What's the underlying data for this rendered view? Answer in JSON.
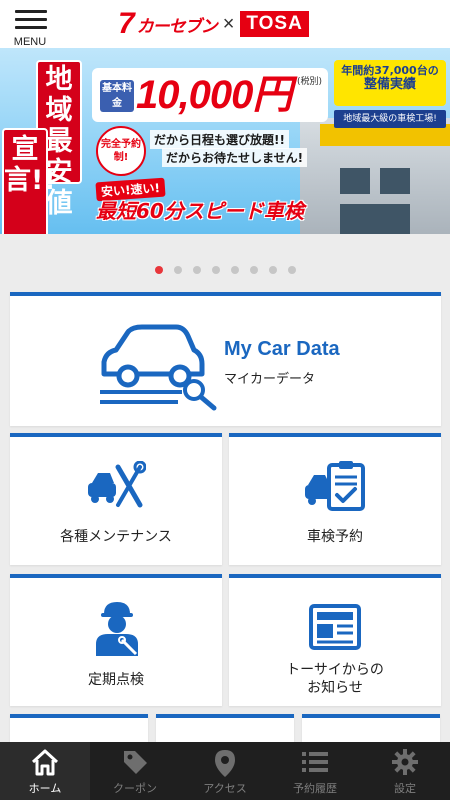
{
  "header": {
    "menu_label": "MENU",
    "logo_seven": "7",
    "logo_brand": "カーセブン",
    "logo_cross": "×",
    "logo_partner": "TOSA"
  },
  "banner": {
    "slogan_line1": "地域最",
    "slogan_line2": "宣言!!",
    "slogan_line3": "安値",
    "price_tag": "基本料金",
    "price_value": "10,000円",
    "price_tax": "(税別)",
    "record_line1": "年間約37,000台の",
    "record_line2": "整備実績",
    "record_sub": "地域最大級の車検工場!",
    "plan_circle": "完全予約制!",
    "plan_line1": "だから日程も選び放題!!",
    "plan_line2": "だからお待たせしません!",
    "speed_tag": "安い!速い!",
    "speed_line": "最短60分スピード車検"
  },
  "carousel": {
    "dot_count": 8,
    "active_index": 0
  },
  "cards": {
    "mycar_title": "My Car Data",
    "mycar_sub": "マイカーデータ",
    "maintenance": "各種メンテナンス",
    "inspection_reserve": "車検予約",
    "periodic_check": "定期点検",
    "news_line1": "トーサイからの",
    "news_line2": "お知らせ"
  },
  "tabs": [
    {
      "label": "ホーム",
      "icon": "home-icon",
      "active": true
    },
    {
      "label": "クーポン",
      "icon": "tag-icon",
      "active": false
    },
    {
      "label": "アクセス",
      "icon": "location-pin-icon",
      "active": false
    },
    {
      "label": "予約履歴",
      "icon": "list-icon",
      "active": false
    },
    {
      "label": "設定",
      "icon": "gear-icon",
      "active": false
    }
  ],
  "colors": {
    "brand_red": "#e60012",
    "accent_blue": "#1a67c0",
    "tabbar_bg": "#1f1f1f",
    "active_dot": "#e8363b"
  }
}
